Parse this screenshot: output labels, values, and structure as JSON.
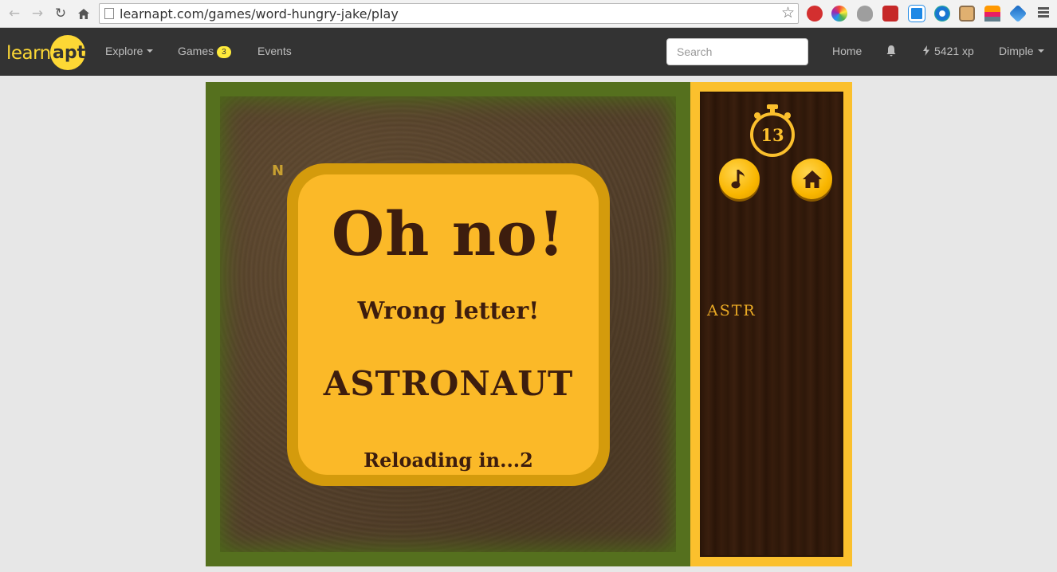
{
  "browser": {
    "url": "learnapt.com/games/word-hungry-jake/play"
  },
  "navbar": {
    "logo_text": "learnapt",
    "logo_word": "learn",
    "logo_accent": "apt",
    "explore_label": "Explore",
    "games_label": "Games",
    "games_badge": "3",
    "events_label": "Events",
    "search_placeholder": "Search",
    "home_label": "Home",
    "xp_label": "5421 xp",
    "user_label": "Dimple"
  },
  "game": {
    "board_letter": "N",
    "dialog": {
      "title": "Oh no!",
      "message": "Wrong letter!",
      "answer": "ASTRONAUT",
      "reload_text": "Reloading in...2"
    },
    "panel": {
      "timer": "13",
      "collected_letters": "ASTR"
    }
  },
  "icons": [
    "back-icon",
    "forward-icon",
    "reload-icon",
    "home-icon",
    "page-icon",
    "star-icon",
    "bell-icon",
    "bolt-icon",
    "stopwatch-icon",
    "music-note-icon",
    "house-icon",
    "menu-icon"
  ],
  "colors": {
    "accent_yellow": "#fbc02d",
    "dialog_text": "#3d1d0e",
    "navbar_bg": "#333333"
  }
}
